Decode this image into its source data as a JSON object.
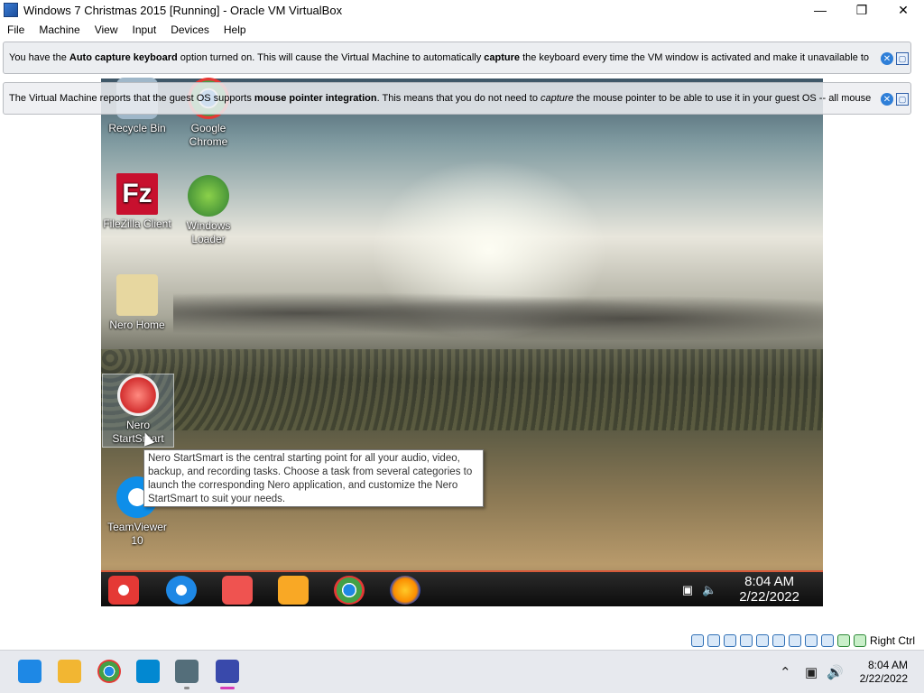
{
  "window": {
    "title": "Windows 7 Christmas 2015 [Running] - Oracle VM VirtualBox",
    "minimize": "—",
    "maximize": "❐",
    "close": "✕"
  },
  "menu": [
    "File",
    "Machine",
    "View",
    "Input",
    "Devices",
    "Help"
  ],
  "notices": [
    {
      "pre": "You have the ",
      "b1": "Auto capture keyboard",
      "mid": " option turned on. This will cause the Virtual Machine to automatically ",
      "b2": "capture",
      "post": " the keyboard every time the VM window is activated and make it unavailable to"
    },
    {
      "pre": "The Virtual Machine reports that the guest OS supports ",
      "b1": "mouse pointer integration",
      "mid": ". This means that you do not need to ",
      "b2": "capture",
      "post": " the mouse pointer to be able to use it in your guest OS -- all mouse"
    }
  ],
  "desktop_icons": [
    {
      "label": "Recycle Bin",
      "icon": "recycle-bin-icon",
      "color": "#9fb7c9"
    },
    {
      "label": "Google Chrome",
      "icon": "chrome-icon",
      "color": "#4caf50"
    },
    {
      "label": "FileZilla Client",
      "icon": "filezilla-icon",
      "color": "#c8102e"
    },
    {
      "label": "Windows Loader",
      "icon": "windows-loader-icon",
      "color": "#6fbf3f"
    },
    {
      "label": "Nero Home",
      "icon": "nero-home-icon",
      "color": "#e7d7a0"
    },
    {
      "label": "Nero StartSmart",
      "icon": "nero-startsmart-icon",
      "color": "#d32f2f"
    },
    {
      "label": "TeamViewer 10",
      "icon": "teamviewer-icon",
      "color": "#0e8ee9"
    }
  ],
  "tooltip": "Nero StartSmart is the central starting point for all your audio, video, backup, and recording tasks. Choose a task from several categories to launch the corresponding Nero application, and customize the Nero StartSmart to suit your needs.",
  "guest_taskbar": {
    "apps": [
      {
        "icon": "santa-start-icon",
        "color": "#e53935"
      },
      {
        "icon": "internet-explorer-icon",
        "color": "#1e88e5"
      },
      {
        "icon": "file-explorer-icon",
        "color": "#ef5350"
      },
      {
        "icon": "media-player-icon",
        "color": "#f9a825"
      },
      {
        "icon": "chrome-icon",
        "color": "#43a047"
      },
      {
        "icon": "firefox-icon",
        "color": "#fb8c00"
      }
    ],
    "time": "8:04 AM",
    "date": "2/22/2022"
  },
  "statusbar": {
    "host_key": "Right Ctrl"
  },
  "host_taskbar": {
    "apps": [
      {
        "icon": "windows-start-icon",
        "color": "#1e88e5"
      },
      {
        "icon": "file-explorer-icon",
        "color": "#f2b632"
      },
      {
        "icon": "chrome-icon",
        "color": "#43a047"
      },
      {
        "icon": "remote-desktop-icon",
        "color": "#0288d1"
      },
      {
        "icon": "virtualbox-icon",
        "color": "#546e7a"
      },
      {
        "icon": "vm-window-icon",
        "color": "#3949ab"
      }
    ],
    "time": "8:04 AM",
    "date": "2/22/2022"
  }
}
